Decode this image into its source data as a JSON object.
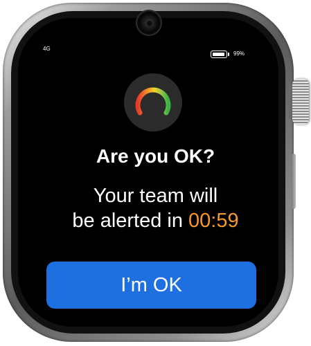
{
  "status_bar": {
    "network": "4G",
    "battery_level": 0.99,
    "battery_label": "99%"
  },
  "gauge": {
    "icon": "gauge-icon",
    "colors": [
      "#e53b2a",
      "#f39a2b",
      "#f4d42a",
      "#8bc34a",
      "#3cb043"
    ]
  },
  "alert": {
    "title": "Are you OK?",
    "line1": "Your team will",
    "line2_prefix": "be alerted in ",
    "countdown": "00:59"
  },
  "actions": {
    "ok_label": "I’m OK"
  },
  "colors": {
    "button": "#1e6fe0",
    "countdown": "#f39a2b",
    "screen": "#000000"
  }
}
